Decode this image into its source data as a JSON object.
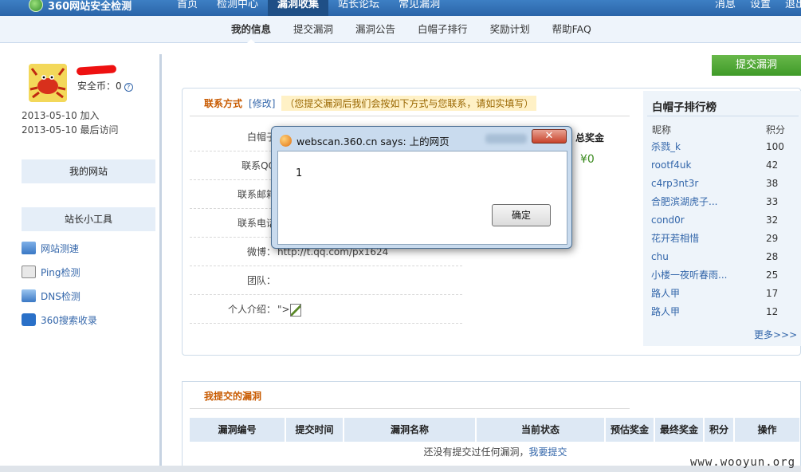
{
  "header": {
    "logo": "360网站安全检测",
    "nav": [
      "首页",
      "检测中心",
      "漏洞收集",
      "站长论坛",
      "常见漏洞"
    ],
    "active_nav": "漏洞收集",
    "right": [
      "消息",
      "设置",
      "退出"
    ]
  },
  "subnav": {
    "items": [
      "我的信息",
      "提交漏洞",
      "漏洞公告",
      "白帽子排行",
      "奖励计划",
      "帮助FAQ"
    ],
    "active": "我的信息"
  },
  "user": {
    "coins": "安全币：0",
    "joined": "2013-05-10 加入",
    "last_visit": "2013-05-10 最后访问"
  },
  "sidebar": {
    "my_site": "我的网站",
    "tools_title": "站长小工具",
    "tools": [
      {
        "label": "网站测速",
        "icon": "monitor-icon",
        "color": "#3a78c4"
      },
      {
        "label": "Ping检测",
        "icon": "ping-icon",
        "color": "#8a8a8a"
      },
      {
        "label": "DNS检测",
        "icon": "dns-icon",
        "color": "#3a78c4"
      },
      {
        "label": "360搜索收录",
        "icon": "search-icon",
        "color": "#2a70c8"
      }
    ]
  },
  "submit_button": "提交漏洞",
  "contact": {
    "title": "联系方式",
    "edit": "[修改]",
    "note": "（您提交漏洞后我们会按如下方式与您联系，请如实填写）",
    "fields": [
      {
        "label": "白帽子",
        "value": ""
      },
      {
        "label": "联系QQ",
        "value": ""
      },
      {
        "label": "联系邮箱",
        "value": ""
      },
      {
        "label": "联系电话",
        "value": ""
      },
      {
        "label": "微博：",
        "value": "http://t.qq.com/px1624"
      },
      {
        "label": "团队：",
        "value": ""
      },
      {
        "label": "个人介绍：",
        "value": "\">"
      }
    ],
    "bonus_label": "总奖金",
    "bonus_value": "¥0"
  },
  "ranking": {
    "title": "白帽子排行榜",
    "col_name": "昵称",
    "col_score": "积分",
    "rows": [
      {
        "name": "杀戮_k",
        "score": "100"
      },
      {
        "name": "rootf4uk",
        "score": "42"
      },
      {
        "name": "c4rp3nt3r",
        "score": "38"
      },
      {
        "name": "合肥滨湖虎子...",
        "score": "33"
      },
      {
        "name": "cond0r",
        "score": "32"
      },
      {
        "name": "花开若相惜",
        "score": "29"
      },
      {
        "name": "chu",
        "score": "28"
      },
      {
        "name": "小楼一夜听春雨...",
        "score": "25"
      },
      {
        "name": "路人甲",
        "score": "17"
      },
      {
        "name": "路人甲",
        "score": "12"
      }
    ],
    "more": "更多>>>"
  },
  "my_vulns": {
    "title": "我提交的漏洞",
    "columns": [
      "漏洞编号",
      "提交时间",
      "漏洞名称",
      "当前状态",
      "预估奖金",
      "最终奖金",
      "积分",
      "操作"
    ],
    "empty_text": "还没有提交过任何漏洞，",
    "empty_link": "我要提交"
  },
  "dialog": {
    "title": "webscan.360.cn says: 上的网页",
    "message": "1",
    "ok": "确定",
    "close": "✕"
  },
  "watermark": "www.wooyun.org"
}
